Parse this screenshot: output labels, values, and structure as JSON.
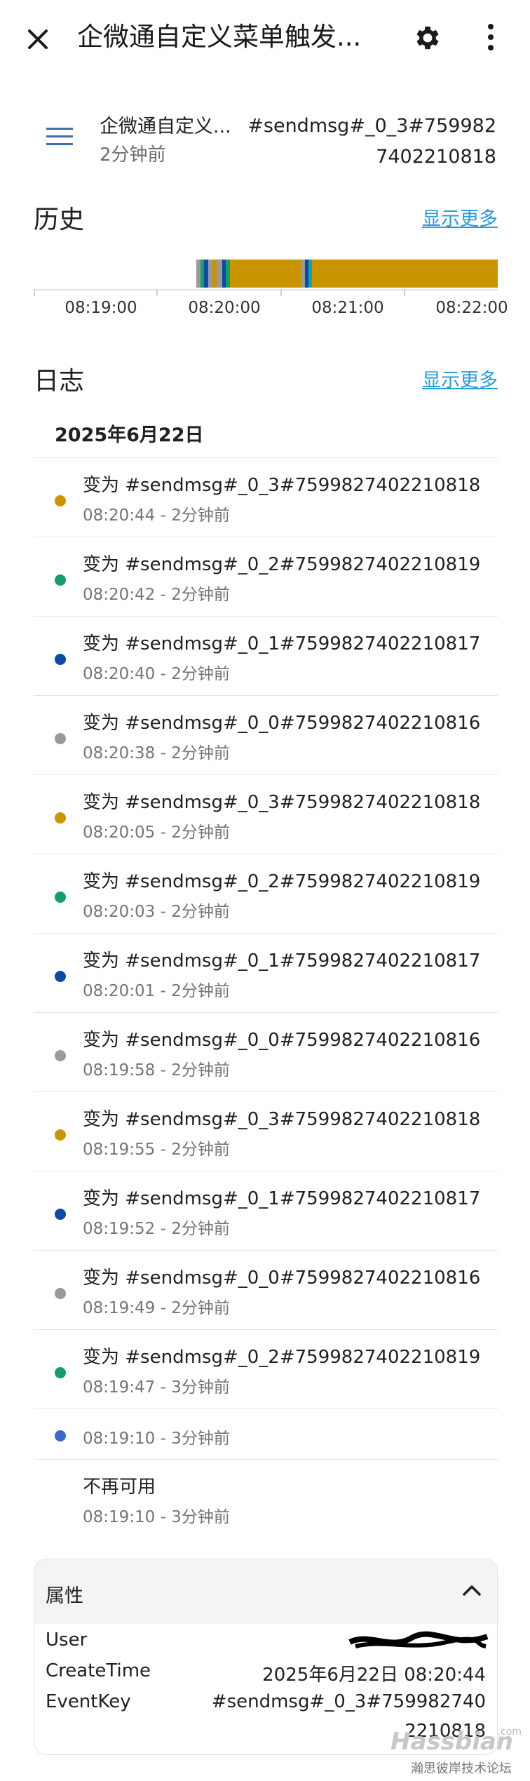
{
  "header": {
    "title": "企微通自定义菜单触发..."
  },
  "entity": {
    "name": "企微通自定义...",
    "last_changed": "2分钟前",
    "state_line1": "#sendmsg#_0_3#759982",
    "state_line2": "7402210818"
  },
  "history": {
    "title": "历史",
    "show_more": "显示更多",
    "x_labels": [
      "08:19:00",
      "08:20:00",
      "08:21:00",
      "08:22:00"
    ],
    "colors": {
      "gold": "#c89400",
      "green": "#139e6a",
      "blue": "#0f4aa0",
      "gray": "#9a9a9a",
      "teal": "#1aa2a0"
    }
  },
  "logbook": {
    "title": "日志",
    "show_more": "显示更多",
    "date": "2025年6月22日",
    "entries": [
      {
        "message": "变为 #sendmsg#_0_3#7599827402210818",
        "time": "08:20:44 - 2分钟前",
        "color": "#c89400"
      },
      {
        "message": "变为 #sendmsg#_0_2#7599827402210819",
        "time": "08:20:42 - 2分钟前",
        "color": "#139e6a"
      },
      {
        "message": "变为 #sendmsg#_0_1#7599827402210817",
        "time": "08:20:40 - 2分钟前",
        "color": "#0f4aa0"
      },
      {
        "message": "变为 #sendmsg#_0_0#7599827402210816",
        "time": "08:20:38 - 2分钟前",
        "color": "#9a9a9a"
      },
      {
        "message": "变为 #sendmsg#_0_3#7599827402210818",
        "time": "08:20:05 - 2分钟前",
        "color": "#c89400"
      },
      {
        "message": "变为 #sendmsg#_0_2#7599827402210819",
        "time": "08:20:03 - 2分钟前",
        "color": "#139e6a"
      },
      {
        "message": "变为 #sendmsg#_0_1#7599827402210817",
        "time": "08:20:01 - 2分钟前",
        "color": "#0f4aa0"
      },
      {
        "message": "变为 #sendmsg#_0_0#7599827402210816",
        "time": "08:19:58 - 2分钟前",
        "color": "#9a9a9a"
      },
      {
        "message": "变为 #sendmsg#_0_3#7599827402210818",
        "time": "08:19:55 - 2分钟前",
        "color": "#c89400"
      },
      {
        "message": "变为 #sendmsg#_0_1#7599827402210817",
        "time": "08:19:52 - 2分钟前",
        "color": "#0f4aa0"
      },
      {
        "message": "变为 #sendmsg#_0_0#7599827402210816",
        "time": "08:19:49 - 2分钟前",
        "color": "#9a9a9a"
      },
      {
        "message": "变为 #sendmsg#_0_2#7599827402210819",
        "time": "08:19:47 - 3分钟前",
        "color": "#139e6a"
      }
    ],
    "short_entry": {
      "time": "08:19:10 - 3分钟前",
      "color": "#3f66c4"
    },
    "unavailable_entry": {
      "message": "不再可用",
      "time": "08:19:10 - 3分钟前"
    }
  },
  "attributes": {
    "title": "属性",
    "rows": [
      {
        "key": "User",
        "value": ""
      },
      {
        "key": "CreateTime",
        "value": "2025年6月22日 08:20:44"
      },
      {
        "key": "EventKey",
        "value": "#sendmsg#_0_3#759982740",
        "value_line2": "2210818"
      }
    ]
  },
  "watermark": {
    "brand": "Hassbian",
    "tag": ".com",
    "caption": "瀚思彼岸技术论坛"
  }
}
